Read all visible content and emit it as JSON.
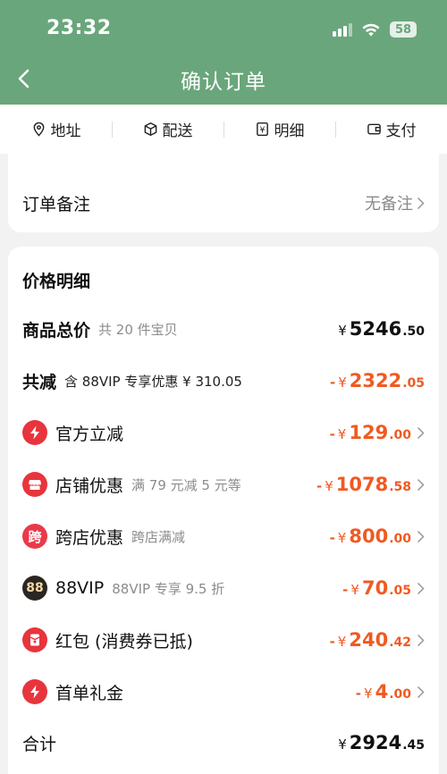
{
  "status_bar": {
    "time": "23:32",
    "battery": "58"
  },
  "header": {
    "title": "确认订单"
  },
  "steps": [
    {
      "label": "地址",
      "icon": "location-pin-icon"
    },
    {
      "label": "配送",
      "icon": "package-icon"
    },
    {
      "label": "明细",
      "icon": "receipt-icon"
    },
    {
      "label": "支付",
      "icon": "wallet-icon"
    }
  ],
  "order_note": {
    "label": "订单备注",
    "value": "无备注"
  },
  "price_detail": {
    "title": "价格明细",
    "items_total": {
      "label": "商品总价",
      "sub": "共 20 件宝贝",
      "currency": "¥",
      "int": "5246",
      "dec": ".50"
    },
    "total_reduction": {
      "label": "共减",
      "sub": "含 88VIP 专享优惠 ¥ 310.05",
      "minus": "-",
      "currency": "¥",
      "int": "2322",
      "dec": ".05"
    },
    "discounts": [
      {
        "label": "官方立减",
        "sub": "",
        "icon": "lightning-icon",
        "minus": "-",
        "currency": "¥",
        "int": "129",
        "dec": ".00"
      },
      {
        "label": "店铺优惠",
        "sub": "满 79 元减 5 元等",
        "icon": "shop-icon",
        "minus": "-",
        "currency": "¥",
        "int": "1078",
        "dec": ".58"
      },
      {
        "label": "跨店优惠",
        "sub": "跨店满减",
        "icon": "cross-store-icon",
        "icon_text": "跨",
        "minus": "-",
        "currency": "¥",
        "int": "800",
        "dec": ".00"
      },
      {
        "label": "88VIP",
        "sub": "88VIP 专享 9.5 折",
        "icon": "vip-88-icon",
        "icon_text": "88",
        "minus": "-",
        "currency": "¥",
        "int": "70",
        "dec": ".05"
      },
      {
        "label": "红包 (消费券已抵)",
        "sub": "",
        "icon": "red-packet-icon",
        "minus": "-",
        "currency": "¥",
        "int": "240",
        "dec": ".42"
      },
      {
        "label": "首单礼金",
        "sub": "",
        "icon": "lightning-icon",
        "minus": "-",
        "currency": "¥",
        "int": "4",
        "dec": ".00"
      }
    ],
    "grand_total": {
      "label": "合计",
      "currency": "¥",
      "int": "2924",
      "dec": ".45"
    }
  },
  "colors": {
    "header_green": "#6aa67b",
    "discount_orange": "#f05a22",
    "icon_red": "#e8343d"
  }
}
